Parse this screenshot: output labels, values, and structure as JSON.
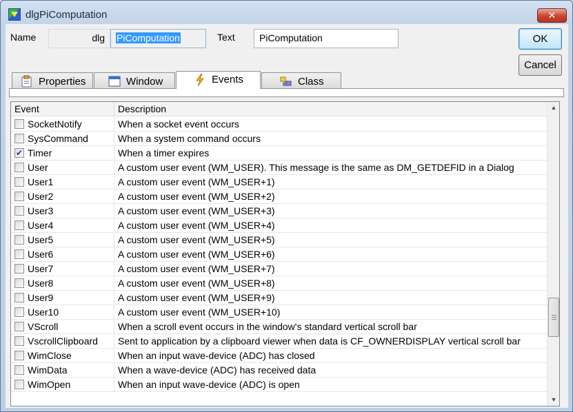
{
  "window": {
    "title": "dlgPiComputation",
    "close_glyph": "✕"
  },
  "form": {
    "name_label": "Name",
    "name_prefix": "dlg",
    "name_value": "PiComputation",
    "text_label": "Text",
    "text_value": "PiComputation"
  },
  "buttons": {
    "ok": "OK",
    "cancel": "Cancel"
  },
  "tabs": [
    {
      "label": "Properties",
      "icon": "properties-icon",
      "active": false
    },
    {
      "label": "Window",
      "icon": "window-icon",
      "active": false
    },
    {
      "label": "Events",
      "icon": "lightning-icon",
      "active": true
    },
    {
      "label": "Class",
      "icon": "class-icon",
      "active": false
    }
  ],
  "grid": {
    "headers": {
      "event": "Event",
      "description": "Description"
    },
    "rows": [
      {
        "event": "SocketNotify",
        "description": "When a socket event occurs",
        "checked": false
      },
      {
        "event": "SysCommand",
        "description": "When a system command occurs",
        "checked": false
      },
      {
        "event": "Timer",
        "description": "When a timer expires",
        "checked": true
      },
      {
        "event": "User",
        "description": "A custom user event (WM_USER).  This message is the same as DM_GETDEFID in a Dialog",
        "checked": false
      },
      {
        "event": "User1",
        "description": "A custom user event (WM_USER+1)",
        "checked": false
      },
      {
        "event": "User2",
        "description": "A custom user event (WM_USER+2)",
        "checked": false
      },
      {
        "event": "User3",
        "description": "A custom user event (WM_USER+3)",
        "checked": false
      },
      {
        "event": "User4",
        "description": "A custom user event (WM_USER+4)",
        "checked": false
      },
      {
        "event": "User5",
        "description": "A custom user event (WM_USER+5)",
        "checked": false
      },
      {
        "event": "User6",
        "description": "A custom user event (WM_USER+6)",
        "checked": false
      },
      {
        "event": "User7",
        "description": "A custom user event (WM_USER+7)",
        "checked": false
      },
      {
        "event": "User8",
        "description": "A custom user event (WM_USER+8)",
        "checked": false
      },
      {
        "event": "User9",
        "description": "A custom user event (WM_USER+9)",
        "checked": false
      },
      {
        "event": "User10",
        "description": "A custom user event (WM_USER+10)",
        "checked": false
      },
      {
        "event": "VScroll",
        "description": "When a scroll event occurs in the window's standard vertical scroll bar",
        "checked": false
      },
      {
        "event": "VscrollClipboard",
        "description": "Sent to application by a clipboard viewer when data is CF_OWNERDISPLAY vertical scroll bar",
        "checked": false
      },
      {
        "event": "WimClose",
        "description": "When an input wave-device (ADC) has closed",
        "checked": false
      },
      {
        "event": "WimData",
        "description": "When a wave-device (ADC) has received data",
        "checked": false
      },
      {
        "event": "WimOpen",
        "description": "When an input wave-device (ADC) is open",
        "checked": false
      }
    ],
    "scroll_up_glyph": "▲",
    "scroll_down_glyph": "▼"
  }
}
